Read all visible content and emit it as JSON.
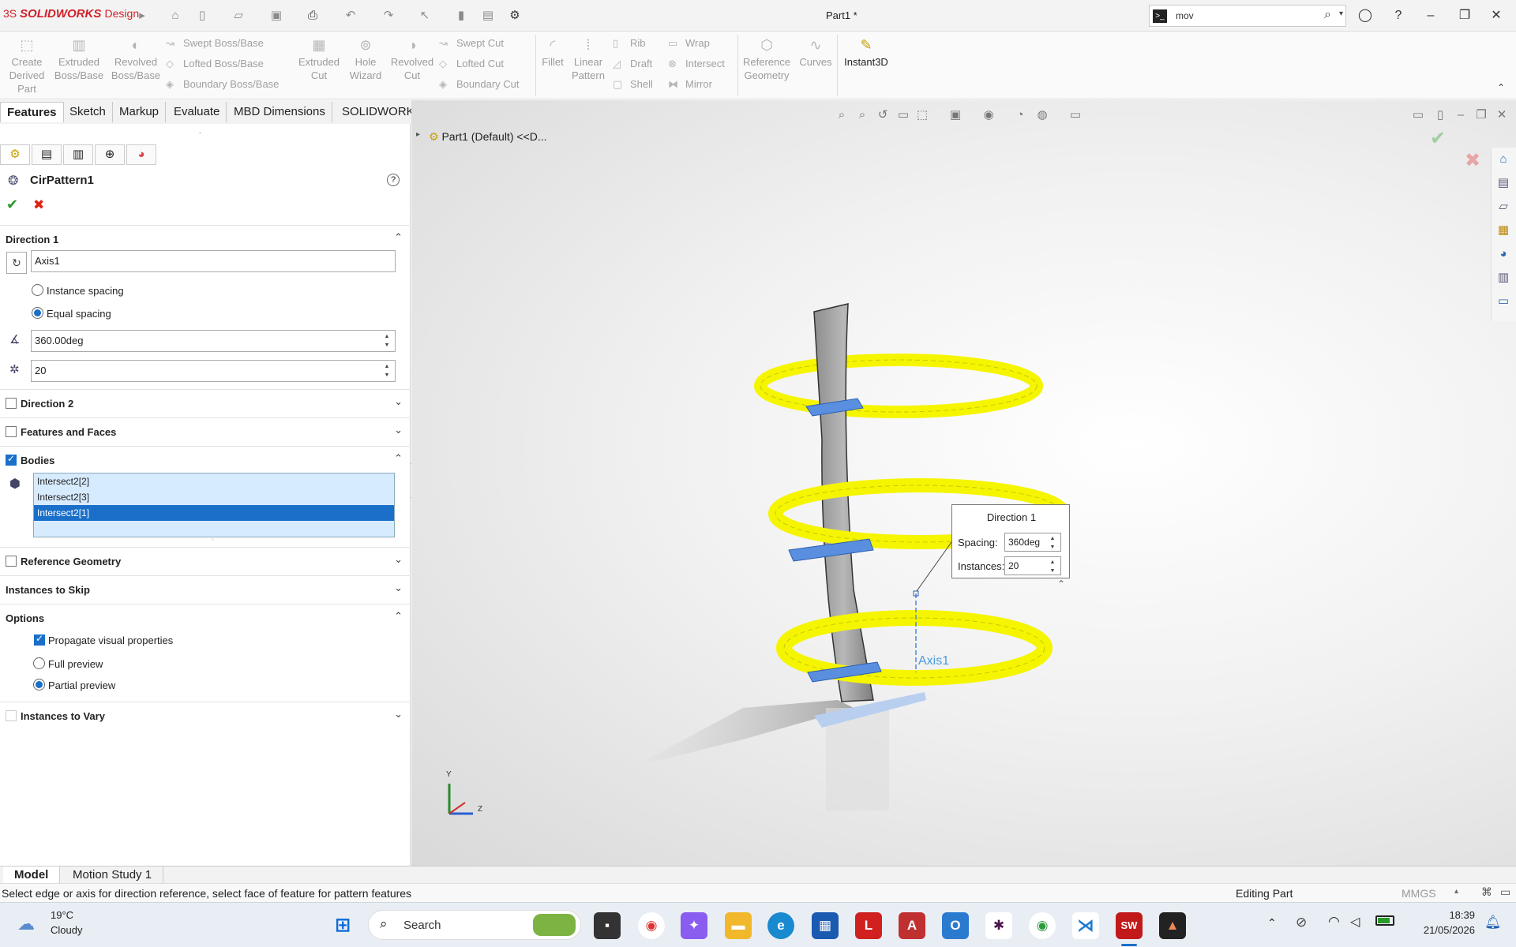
{
  "app": {
    "brand": "SOLIDWORKS",
    "edition": "Design",
    "document_title": "Part1 *"
  },
  "search": {
    "value": "mov"
  },
  "ribbon": {
    "create_derived_part": "Create\nDerived\nPart",
    "extruded_boss": "Extruded\nBoss/Base",
    "revolved_boss": "Revolved\nBoss/Base",
    "swept_boss": "Swept Boss/Base",
    "lofted_boss": "Lofted Boss/Base",
    "boundary_boss": "Boundary Boss/Base",
    "extruded_cut": "Extruded\nCut",
    "hole_wizard": "Hole\nWizard",
    "revolved_cut": "Revolved\nCut",
    "swept_cut": "Swept Cut",
    "lofted_cut": "Lofted Cut",
    "boundary_cut": "Boundary Cut",
    "fillet": "Fillet",
    "linear_pattern": "Linear\nPattern",
    "rib": "Rib",
    "draft": "Draft",
    "shell": "Shell",
    "wrap": "Wrap",
    "intersect": "Intersect",
    "mirror": "Mirror",
    "reference_geometry": "Reference\nGeometry",
    "curves": "Curves",
    "instant3d": "Instant3D"
  },
  "tabs": [
    "Features",
    "Sketch",
    "Markup",
    "Evaluate",
    "MBD Dimensions",
    "SOLIDWORKS Add-Ins"
  ],
  "property_manager": {
    "feature_name": "CirPattern1",
    "direction1": {
      "label": "Direction 1",
      "axis": "Axis1",
      "instance_spacing": "Instance spacing",
      "equal_spacing": "Equal spacing",
      "angle": "360.00deg",
      "instances": "20"
    },
    "direction2": "Direction 2",
    "features_and_faces": "Features and Faces",
    "bodies": {
      "label": "Bodies",
      "items": [
        "Intersect2[2]",
        "Intersect2[3]",
        "Intersect2[1]"
      ]
    },
    "reference_geometry": "Reference Geometry",
    "instances_to_skip": "Instances to Skip",
    "options": {
      "label": "Options",
      "propagate": "Propagate visual properties",
      "full_preview": "Full preview",
      "partial_preview": "Partial preview"
    },
    "instances_to_vary": "Instances to Vary"
  },
  "viewport": {
    "breadcrumb": "Part1 (Default) <<D...",
    "callout": {
      "title": "Direction 1",
      "spacing_label": "Spacing:",
      "spacing": "360deg",
      "instances_label": "Instances:",
      "instances": "20"
    },
    "axis_label": "Axis1",
    "triad": {
      "y": "Y",
      "z": "Z"
    }
  },
  "bottom_tabs": [
    "Model",
    "Motion Study 1"
  ],
  "status": {
    "message": "Select edge or axis for direction reference, select face of feature for pattern features",
    "mode": "Editing Part",
    "units": "MMGS"
  },
  "taskbar": {
    "temp": "19°C",
    "weather": "Cloudy",
    "search": "Search",
    "time": "18:39",
    "date": "21/05/2026"
  }
}
